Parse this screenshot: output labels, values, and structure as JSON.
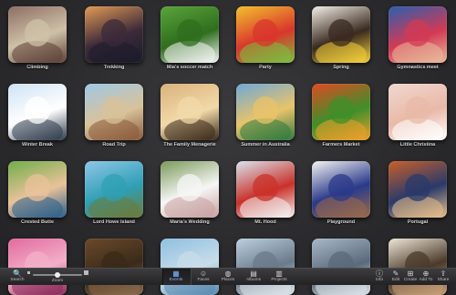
{
  "albums": [
    {
      "label": "Climbing",
      "colors": [
        "#8d6e63",
        "#cfc1a8",
        "#5d4037"
      ]
    },
    {
      "label": "Trekking",
      "colors": [
        "#e39a55",
        "#3b2a3a",
        "#1b1b2a"
      ]
    },
    {
      "label": "Mia's soccer match",
      "colors": [
        "#5aa43a",
        "#2f6e1e",
        "#f5f5f5"
      ]
    },
    {
      "label": "Party",
      "colors": [
        "#f2c12e",
        "#d9362c",
        "#7cbf3f"
      ]
    },
    {
      "label": "Spring",
      "colors": [
        "#f3efe6",
        "#3a2a20",
        "#f5d23a"
      ]
    },
    {
      "label": "Gymnastics meet",
      "colors": [
        "#2a5fb0",
        "#d23a54",
        "#e9b99a"
      ]
    },
    {
      "label": "Winter Break",
      "colors": [
        "#cfe2f5",
        "#ffffff",
        "#2d3a4a"
      ]
    },
    {
      "label": "Road Trip",
      "colors": [
        "#9fc8e6",
        "#d8c29a",
        "#8a5a3a"
      ]
    },
    {
      "label": "The Family Menagerie",
      "colors": [
        "#d9b27c",
        "#f2d9a8",
        "#3a2a1a"
      ]
    },
    {
      "label": "Summer in Australia",
      "colors": [
        "#6fa8d8",
        "#e9c36a",
        "#2e7a3e"
      ]
    },
    {
      "label": "Farmers Market",
      "colors": [
        "#e04a23",
        "#3f8f2a",
        "#f0a029"
      ]
    },
    {
      "label": "Little Christina",
      "colors": [
        "#f0d8cf",
        "#e9b9a8",
        "#ffffff"
      ]
    },
    {
      "label": "Crested Butte",
      "colors": [
        "#6fae4a",
        "#e9c29a",
        "#2a5e8a"
      ]
    },
    {
      "label": "Lord Howe Island",
      "colors": [
        "#8fc6e8",
        "#2fa0b4",
        "#6b7a3a"
      ]
    },
    {
      "label": "Maria's Wedding",
      "colors": [
        "#7a9a5a",
        "#f6f6f6",
        "#c9a0a0"
      ]
    },
    {
      "label": "Mt. Hood",
      "colors": [
        "#d9e4ee",
        "#c9312a",
        "#f4f4f4"
      ]
    },
    {
      "label": "Playground",
      "colors": [
        "#f4f4f2",
        "#2b3a8a",
        "#9a6a4a"
      ]
    },
    {
      "label": "Portugal",
      "colors": [
        "#c8602a",
        "#2a3a6a",
        "#e8c08a"
      ]
    },
    {
      "label": "",
      "colors": [
        "#e26aa0",
        "#f3b0c8",
        "#8a2a5a"
      ]
    },
    {
      "label": "",
      "colors": [
        "#6a4a2a",
        "#3a2a1a",
        "#8a6a4a"
      ]
    },
    {
      "label": "",
      "colors": [
        "#8fc0e0",
        "#c8dcea",
        "#5a8ab0"
      ]
    },
    {
      "label": "",
      "colors": [
        "#bcd0de",
        "#6a7a8a",
        "#dfe6ec"
      ]
    },
    {
      "label": "",
      "colors": [
        "#a8b8c8",
        "#5a6a7a",
        "#dde4ea"
      ]
    },
    {
      "label": "",
      "colors": [
        "#efe6d8",
        "#4a3a2a",
        "#c9a07a"
      ]
    }
  ],
  "toolbar": {
    "search": {
      "icon": "🔍",
      "label": "Search"
    },
    "zoom": {
      "label": "Zoom",
      "value": 0.5
    },
    "tabs": [
      {
        "icon": "▦",
        "label": "Events",
        "active": true
      },
      {
        "icon": "☺",
        "label": "Faces",
        "active": false
      },
      {
        "icon": "◍",
        "label": "Places",
        "active": false
      },
      {
        "icon": "▤",
        "label": "Albums",
        "active": false
      },
      {
        "icon": "▥",
        "label": "Projects",
        "active": false
      }
    ],
    "actions": [
      {
        "icon": "ⓘ",
        "label": "Info"
      },
      {
        "icon": "✎",
        "label": "Edit"
      },
      {
        "icon": "⊞",
        "label": "Create"
      },
      {
        "icon": "⊕",
        "label": "Add To"
      },
      {
        "icon": "⇪",
        "label": "Share"
      }
    ]
  }
}
